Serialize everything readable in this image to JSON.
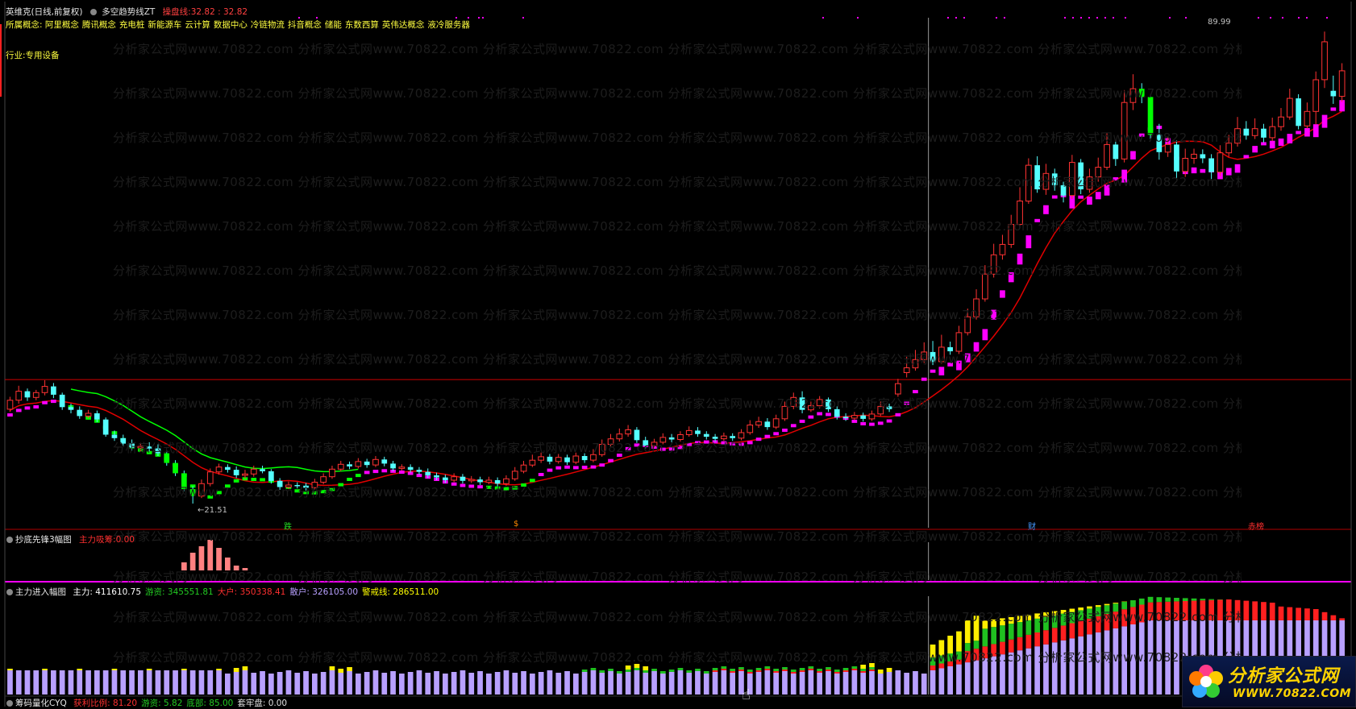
{
  "window": {
    "title": "英维克(日线,前复权)",
    "indicator_name": "多空趋势线ZT",
    "indicator_value_label": "操盘线:",
    "indicator_value": "32.82 : 32.82",
    "concepts_label": "所属概念:",
    "concepts": [
      "阿里概念",
      "腾讯概念",
      "充电桩",
      "新能源车",
      "云计算",
      "数据中心",
      "冷链物流",
      "抖音概念",
      "储能",
      "东数西算",
      "英伟达概念",
      "液冷服务器"
    ],
    "industry_label": "行业:",
    "industry": "专用设备"
  },
  "main_chart": {
    "price_high_label": "89.99",
    "price_low_label": "21.51",
    "signal_labels": [
      "跌",
      "$",
      "财",
      "赤榜"
    ]
  },
  "pane2": {
    "title": "抄底先锋3幅图",
    "value_label": "主力吸筹:",
    "value": "0.00"
  },
  "pane3": {
    "title": "主力进入幅图",
    "items": [
      {
        "label": "主力:",
        "value": "411610.75",
        "color": "#ffffff"
      },
      {
        "label": "游资:",
        "value": "345551.81",
        "color": "#22cc22"
      },
      {
        "label": "大户:",
        "value": "350338.41",
        "color": "#ff3030"
      },
      {
        "label": "散户:",
        "value": "326105.00",
        "color": "#b8a0ff"
      },
      {
        "label": "警戒线:",
        "value": "286511.00",
        "color": "#ffff00"
      }
    ]
  },
  "pane4": {
    "title": "筹码量化CYQ",
    "items": [
      {
        "label": "获利比例:",
        "value": "81.20"
      },
      {
        "label": "游资:",
        "value": "5.82"
      },
      {
        "label": "底部:",
        "value": "85.00"
      },
      {
        "label": "套牢盘:",
        "value": "0.00"
      }
    ]
  },
  "watermark": {
    "text": "分析家公式网www.70822.com"
  },
  "logo": {
    "title": "分析家公式网",
    "url": "WWW.70822.COM"
  },
  "colors": {
    "up": "#ff3232",
    "down": "#54ffff",
    "magenta": "#ff00ff",
    "green": "#00ff00",
    "ma_red": "#e00000",
    "bg": "#000000"
  },
  "chart_data": {
    "type": "candlestick",
    "ylim": [
      18,
      92
    ],
    "bars": [
      {
        "o": 35.2,
        "c": 36.5,
        "h": 37.0,
        "l": 34.8
      },
      {
        "o": 36.5,
        "c": 37.8,
        "h": 38.6,
        "l": 36.0
      },
      {
        "o": 37.8,
        "c": 36.9,
        "h": 38.2,
        "l": 36.4
      },
      {
        "o": 36.9,
        "c": 37.6,
        "h": 38.0,
        "l": 36.5
      },
      {
        "o": 37.6,
        "c": 38.5,
        "h": 39.4,
        "l": 37.2
      },
      {
        "o": 38.5,
        "c": 37.3,
        "h": 39.0,
        "l": 36.8
      },
      {
        "o": 37.3,
        "c": 35.5,
        "h": 37.6,
        "l": 35.1
      },
      {
        "o": 35.5,
        "c": 35.1,
        "h": 36.0,
        "l": 34.6
      },
      {
        "o": 35.1,
        "c": 34.2,
        "h": 35.6,
        "l": 33.8
      },
      {
        "o": 34.2,
        "c": 34.6,
        "h": 35.1,
        "l": 33.9
      },
      {
        "o": 34.6,
        "c": 33.7,
        "h": 35.0,
        "l": 33.3
      },
      {
        "o": 33.7,
        "c": 31.5,
        "h": 34.0,
        "l": 31.2
      },
      {
        "o": 31.5,
        "c": 31.0,
        "h": 32.1,
        "l": 30.6
      },
      {
        "o": 31.0,
        "c": 30.2,
        "h": 31.5,
        "l": 29.8
      },
      {
        "o": 30.2,
        "c": 29.6,
        "h": 30.8,
        "l": 29.2
      },
      {
        "o": 29.6,
        "c": 29.8,
        "h": 30.3,
        "l": 29.0
      },
      {
        "o": 29.8,
        "c": 29.5,
        "h": 30.4,
        "l": 29.1
      },
      {
        "o": 29.5,
        "c": 28.8,
        "h": 30.1,
        "l": 28.4
      },
      {
        "o": 28.8,
        "c": 27.4,
        "h": 29.2,
        "l": 27.0
      },
      {
        "o": 27.4,
        "c": 25.9,
        "h": 27.8,
        "l": 25.5
      },
      {
        "o": 25.9,
        "c": 23.6,
        "h": 26.3,
        "l": 23.3
      },
      {
        "o": 23.6,
        "c": 22.6,
        "h": 24.0,
        "l": 21.5
      },
      {
        "o": 22.6,
        "c": 24.4,
        "h": 25.0,
        "l": 22.3
      },
      {
        "o": 24.4,
        "c": 26.1,
        "h": 26.6,
        "l": 24.0
      },
      {
        "o": 26.1,
        "c": 26.8,
        "h": 27.3,
        "l": 25.7
      },
      {
        "o": 26.8,
        "c": 26.4,
        "h": 27.2,
        "l": 26.0
      },
      {
        "o": 26.4,
        "c": 25.6,
        "h": 26.9,
        "l": 25.2
      },
      {
        "o": 25.6,
        "c": 25.8,
        "h": 26.4,
        "l": 25.1
      },
      {
        "o": 25.8,
        "c": 26.5,
        "h": 27.0,
        "l": 25.4
      },
      {
        "o": 26.5,
        "c": 26.2,
        "h": 27.0,
        "l": 25.9
      },
      {
        "o": 26.2,
        "c": 24.8,
        "h": 26.5,
        "l": 24.4
      },
      {
        "o": 24.8,
        "c": 23.9,
        "h": 25.2,
        "l": 23.5
      },
      {
        "o": 23.9,
        "c": 24.2,
        "h": 24.7,
        "l": 23.6
      },
      {
        "o": 24.2,
        "c": 24.1,
        "h": 24.6,
        "l": 23.7
      },
      {
        "o": 24.1,
        "c": 23.8,
        "h": 24.5,
        "l": 23.4
      },
      {
        "o": 23.8,
        "c": 24.6,
        "h": 25.1,
        "l": 23.5
      },
      {
        "o": 24.6,
        "c": 25.4,
        "h": 25.9,
        "l": 24.3
      },
      {
        "o": 25.4,
        "c": 26.5,
        "h": 27.0,
        "l": 25.1
      },
      {
        "o": 26.5,
        "c": 27.2,
        "h": 27.7,
        "l": 26.2
      },
      {
        "o": 27.2,
        "c": 26.9,
        "h": 27.6,
        "l": 26.5
      },
      {
        "o": 26.9,
        "c": 27.6,
        "h": 28.1,
        "l": 26.6
      },
      {
        "o": 27.6,
        "c": 27.1,
        "h": 28.0,
        "l": 26.7
      },
      {
        "o": 27.1,
        "c": 27.9,
        "h": 28.4,
        "l": 26.8
      },
      {
        "o": 27.9,
        "c": 27.3,
        "h": 28.3,
        "l": 26.9
      },
      {
        "o": 27.3,
        "c": 26.6,
        "h": 27.7,
        "l": 26.2
      },
      {
        "o": 26.6,
        "c": 26.8,
        "h": 27.2,
        "l": 26.3
      },
      {
        "o": 26.8,
        "c": 26.4,
        "h": 27.2,
        "l": 26.0
      },
      {
        "o": 26.4,
        "c": 26.1,
        "h": 26.8,
        "l": 25.7
      },
      {
        "o": 26.1,
        "c": 25.6,
        "h": 26.6,
        "l": 25.2
      },
      {
        "o": 25.6,
        "c": 25.3,
        "h": 26.0,
        "l": 24.9
      },
      {
        "o": 25.3,
        "c": 24.9,
        "h": 25.7,
        "l": 24.5
      },
      {
        "o": 24.9,
        "c": 25.4,
        "h": 25.9,
        "l": 24.6
      },
      {
        "o": 25.4,
        "c": 24.8,
        "h": 25.8,
        "l": 24.4
      },
      {
        "o": 24.8,
        "c": 25.0,
        "h": 25.5,
        "l": 24.5
      },
      {
        "o": 25.0,
        "c": 24.6,
        "h": 25.4,
        "l": 24.2
      },
      {
        "o": 24.6,
        "c": 24.9,
        "h": 25.4,
        "l": 24.3
      },
      {
        "o": 24.9,
        "c": 24.4,
        "h": 25.3,
        "l": 24.0
      },
      {
        "o": 24.4,
        "c": 25.1,
        "h": 25.6,
        "l": 24.1
      },
      {
        "o": 25.1,
        "c": 26.2,
        "h": 26.8,
        "l": 24.8
      },
      {
        "o": 26.2,
        "c": 27.1,
        "h": 27.7,
        "l": 25.9
      },
      {
        "o": 27.1,
        "c": 27.8,
        "h": 28.6,
        "l": 26.8
      },
      {
        "o": 27.8,
        "c": 28.3,
        "h": 28.9,
        "l": 27.4
      },
      {
        "o": 28.3,
        "c": 27.6,
        "h": 28.7,
        "l": 27.2
      },
      {
        "o": 27.6,
        "c": 28.2,
        "h": 28.7,
        "l": 27.3
      },
      {
        "o": 28.2,
        "c": 27.5,
        "h": 28.6,
        "l": 27.1
      },
      {
        "o": 27.5,
        "c": 28.4,
        "h": 28.9,
        "l": 27.2
      },
      {
        "o": 28.4,
        "c": 27.8,
        "h": 28.8,
        "l": 27.4
      },
      {
        "o": 27.8,
        "c": 28.6,
        "h": 29.4,
        "l": 27.5
      },
      {
        "o": 28.6,
        "c": 30.1,
        "h": 30.8,
        "l": 28.3
      },
      {
        "o": 30.1,
        "c": 30.9,
        "h": 31.6,
        "l": 29.8
      },
      {
        "o": 30.9,
        "c": 31.6,
        "h": 32.4,
        "l": 30.5
      },
      {
        "o": 31.6,
        "c": 32.2,
        "h": 32.9,
        "l": 31.2
      },
      {
        "o": 32.2,
        "c": 30.7,
        "h": 32.6,
        "l": 30.3
      },
      {
        "o": 30.7,
        "c": 29.9,
        "h": 31.2,
        "l": 29.5
      },
      {
        "o": 29.9,
        "c": 30.4,
        "h": 30.9,
        "l": 29.6
      },
      {
        "o": 30.4,
        "c": 31.1,
        "h": 31.7,
        "l": 30.1
      },
      {
        "o": 31.1,
        "c": 30.8,
        "h": 31.6,
        "l": 30.4
      },
      {
        "o": 30.8,
        "c": 31.5,
        "h": 32.0,
        "l": 30.5
      },
      {
        "o": 31.5,
        "c": 32.1,
        "h": 32.7,
        "l": 31.2
      },
      {
        "o": 32.1,
        "c": 31.6,
        "h": 32.6,
        "l": 31.2
      },
      {
        "o": 31.6,
        "c": 31.2,
        "h": 32.0,
        "l": 30.8
      },
      {
        "o": 31.2,
        "c": 30.9,
        "h": 31.6,
        "l": 30.5
      },
      {
        "o": 30.9,
        "c": 31.3,
        "h": 31.8,
        "l": 30.6
      },
      {
        "o": 31.3,
        "c": 31.0,
        "h": 31.7,
        "l": 30.6
      },
      {
        "o": 31.0,
        "c": 31.8,
        "h": 32.3,
        "l": 30.7
      },
      {
        "o": 31.8,
        "c": 32.9,
        "h": 33.6,
        "l": 31.5
      },
      {
        "o": 32.9,
        "c": 33.4,
        "h": 34.1,
        "l": 32.5
      },
      {
        "o": 33.4,
        "c": 32.6,
        "h": 33.9,
        "l": 32.2
      },
      {
        "o": 32.6,
        "c": 33.8,
        "h": 34.4,
        "l": 32.3
      },
      {
        "o": 33.8,
        "c": 35.6,
        "h": 36.3,
        "l": 33.5
      },
      {
        "o": 35.6,
        "c": 36.9,
        "h": 37.6,
        "l": 35.2
      },
      {
        "o": 36.9,
        "c": 35.1,
        "h": 37.8,
        "l": 34.6
      },
      {
        "o": 35.1,
        "c": 35.7,
        "h": 36.3,
        "l": 34.8
      },
      {
        "o": 35.7,
        "c": 36.6,
        "h": 37.1,
        "l": 35.3
      },
      {
        "o": 36.6,
        "c": 35.2,
        "h": 36.9,
        "l": 34.8
      },
      {
        "o": 35.2,
        "c": 34.1,
        "h": 35.6,
        "l": 33.7
      },
      {
        "o": 34.1,
        "c": 33.9,
        "h": 34.6,
        "l": 33.5
      },
      {
        "o": 33.9,
        "c": 34.3,
        "h": 34.8,
        "l": 33.6
      },
      {
        "o": 34.3,
        "c": 33.8,
        "h": 34.7,
        "l": 33.4
      },
      {
        "o": 33.8,
        "c": 34.5,
        "h": 35.0,
        "l": 33.5
      },
      {
        "o": 34.5,
        "c": 35.6,
        "h": 36.3,
        "l": 34.2
      },
      {
        "o": 35.6,
        "c": 35.2,
        "h": 36.0,
        "l": 34.8
      },
      {
        "o": 37.4,
        "c": 38.9,
        "h": 39.6,
        "l": 37.0
      },
      {
        "o": 40.5,
        "c": 41.2,
        "h": 42.8,
        "l": 39.8
      },
      {
        "o": 41.2,
        "c": 42.4,
        "h": 43.8,
        "l": 40.8
      },
      {
        "o": 42.4,
        "c": 43.5,
        "h": 44.9,
        "l": 41.9
      },
      {
        "o": 43.5,
        "c": 42.1,
        "h": 45.1,
        "l": 41.6
      },
      {
        "o": 42.1,
        "c": 44.2,
        "h": 46.0,
        "l": 41.8
      },
      {
        "o": 44.2,
        "c": 43.6,
        "h": 45.0,
        "l": 43.1
      },
      {
        "o": 43.6,
        "c": 46.3,
        "h": 47.3,
        "l": 43.2
      },
      {
        "o": 46.3,
        "c": 48.6,
        "h": 49.8,
        "l": 45.9
      },
      {
        "o": 48.6,
        "c": 51.2,
        "h": 52.6,
        "l": 48.2
      },
      {
        "o": 51.2,
        "c": 54.8,
        "h": 56.1,
        "l": 50.8
      },
      {
        "o": 54.8,
        "c": 57.6,
        "h": 59.2,
        "l": 54.3
      },
      {
        "o": 57.6,
        "c": 59.1,
        "h": 60.5,
        "l": 56.9
      },
      {
        "o": 59.1,
        "c": 62.0,
        "h": 63.4,
        "l": 58.6
      },
      {
        "o": 62.0,
        "c": 65.4,
        "h": 67.4,
        "l": 61.5
      },
      {
        "o": 65.4,
        "c": 70.6,
        "h": 71.6,
        "l": 65.0
      },
      {
        "o": 70.6,
        "c": 67.1,
        "h": 71.9,
        "l": 66.6
      },
      {
        "o": 67.1,
        "c": 69.4,
        "h": 70.8,
        "l": 66.3
      },
      {
        "o": 69.4,
        "c": 67.7,
        "h": 70.1,
        "l": 66.9
      },
      {
        "o": 67.7,
        "c": 66.2,
        "h": 68.2,
        "l": 65.2
      },
      {
        "o": 66.2,
        "c": 71.0,
        "h": 72.1,
        "l": 65.7
      },
      {
        "o": 71.0,
        "c": 67.1,
        "h": 71.5,
        "l": 66.4
      },
      {
        "o": 67.1,
        "c": 68.9,
        "h": 70.1,
        "l": 66.6
      },
      {
        "o": 68.9,
        "c": 70.3,
        "h": 71.7,
        "l": 68.2
      },
      {
        "o": 70.3,
        "c": 73.6,
        "h": 75.3,
        "l": 69.9
      },
      {
        "o": 73.6,
        "c": 71.5,
        "h": 74.0,
        "l": 70.5
      },
      {
        "o": 71.5,
        "c": 79.7,
        "h": 81.5,
        "l": 71.0
      },
      {
        "o": 79.7,
        "c": 81.7,
        "h": 83.8,
        "l": 78.6
      },
      {
        "o": 81.7,
        "c": 80.5,
        "h": 82.5,
        "l": 79.6
      },
      {
        "o": 80.5,
        "c": 75.0,
        "h": 80.8,
        "l": 74.4
      },
      {
        "o": 75.0,
        "c": 72.5,
        "h": 76.6,
        "l": 71.4
      },
      {
        "o": 72.5,
        "c": 73.6,
        "h": 74.7,
        "l": 71.8
      },
      {
        "o": 73.6,
        "c": 69.7,
        "h": 74.2,
        "l": 68.6
      },
      {
        "o": 69.7,
        "c": 71.6,
        "h": 73.0,
        "l": 68.9
      },
      {
        "o": 71.6,
        "c": 72.2,
        "h": 73.0,
        "l": 70.8
      },
      {
        "o": 72.2,
        "c": 71.6,
        "h": 72.9,
        "l": 70.9
      },
      {
        "o": 71.6,
        "c": 69.6,
        "h": 72.2,
        "l": 68.6
      },
      {
        "o": 69.6,
        "c": 72.4,
        "h": 73.5,
        "l": 69.0
      },
      {
        "o": 72.4,
        "c": 73.8,
        "h": 75.0,
        "l": 71.8
      },
      {
        "o": 73.8,
        "c": 75.9,
        "h": 77.6,
        "l": 73.3
      },
      {
        "o": 75.9,
        "c": 74.9,
        "h": 77.0,
        "l": 74.3
      },
      {
        "o": 74.9,
        "c": 75.9,
        "h": 77.4,
        "l": 74.4
      },
      {
        "o": 75.9,
        "c": 74.6,
        "h": 76.6,
        "l": 73.9
      },
      {
        "o": 74.6,
        "c": 76.2,
        "h": 77.5,
        "l": 74.1
      },
      {
        "o": 76.2,
        "c": 77.6,
        "h": 78.9,
        "l": 75.6
      },
      {
        "o": 77.6,
        "c": 80.3,
        "h": 81.7,
        "l": 77.2
      },
      {
        "o": 80.3,
        "c": 76.3,
        "h": 80.9,
        "l": 75.8
      },
      {
        "o": 76.3,
        "c": 78.4,
        "h": 79.7,
        "l": 75.9
      },
      {
        "o": 78.4,
        "c": 83.0,
        "h": 84.2,
        "l": 76.5
      },
      {
        "o": 83.0,
        "c": 88.5,
        "h": 89.99,
        "l": 81.8
      },
      {
        "o": 81.4,
        "c": 80.6,
        "h": 83.6,
        "l": 79.5
      },
      {
        "o": 80.6,
        "c": 84.3,
        "h": 85.4,
        "l": 79.8
      }
    ],
    "horizontal_line": 39.5,
    "signals": [
      "跌",
      "$",
      "财",
      "赤榜"
    ]
  }
}
